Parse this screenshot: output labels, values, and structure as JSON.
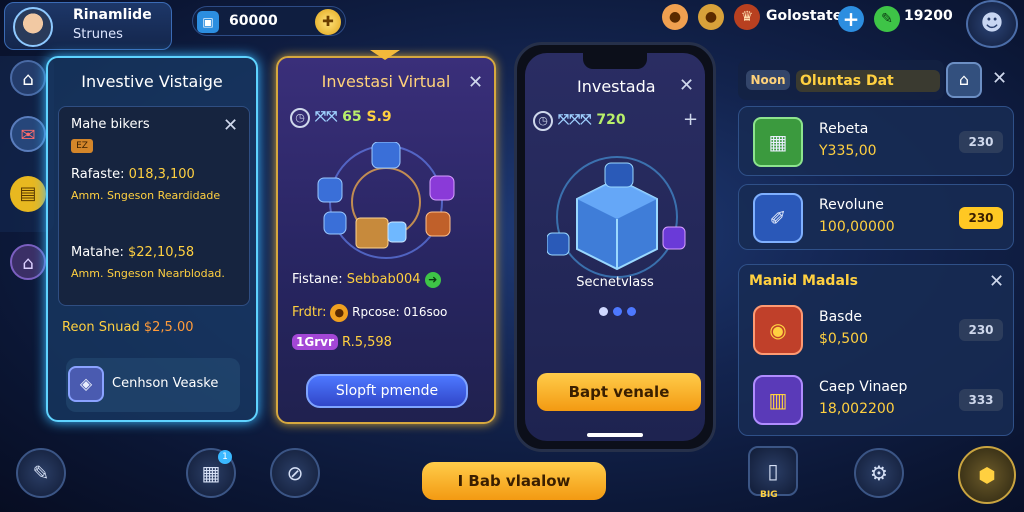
{
  "profile": {
    "name": "Rinamlide",
    "subtitle": "Strunes"
  },
  "top": {
    "coins": "60000",
    "resources_label": "Golostate",
    "gems": "19200"
  },
  "panel_left": {
    "title": "Investive Vistaige",
    "card_title": "Mahe bikers",
    "card_badge": "EZ",
    "row1_label": "Rafaste:",
    "row1_value": "018,3,100",
    "row1_sub": "Amm. Sngeson Reardidade",
    "row2_label": "Matahe:",
    "row2_value": "$22,10,58",
    "row2_sub": "Amm. Sngeson Nearblodad.",
    "total_label": "Reon Snuad",
    "total_value": "$2,5.00",
    "button_label": "Cenhson Veaske"
  },
  "panel_mid": {
    "title": "Investasi Virtual",
    "stat_value": "S.9",
    "stat_prefix": "65",
    "row1_label": "Fistane:",
    "row1_value": "Sebbab004",
    "row2_label": "Frdtr:",
    "row2_value": "Rpcose: 016soo",
    "badge": "1Grvr",
    "badge_value": "R.5,598",
    "button_label": "Slopft pmende"
  },
  "phone": {
    "title": "Investada",
    "stat_value": "720",
    "label": "Secnetvlass",
    "button_label": "Bapt venale"
  },
  "right_top": {
    "tab1": "Noon",
    "tab2": "Oluntas Dat",
    "items": [
      {
        "name": "Rebeta",
        "value": "Y335,00",
        "badge": "230"
      },
      {
        "name": "Revolune",
        "value": "100,00000",
        "badge": "230"
      }
    ]
  },
  "right_bottom": {
    "title": "Manid Madals",
    "items": [
      {
        "name": "Basde",
        "value": "$0,500",
        "badge": "230"
      },
      {
        "name": "Caep Vinaep",
        "value": "18,002200",
        "badge": "333"
      }
    ]
  },
  "bottom": {
    "main_button": "I Bab vlaalow",
    "item_label": "BIG"
  },
  "colors": {
    "gold": "#ffd040",
    "accent": "#5fd3ff",
    "blue_btn": "#3a55e0"
  }
}
